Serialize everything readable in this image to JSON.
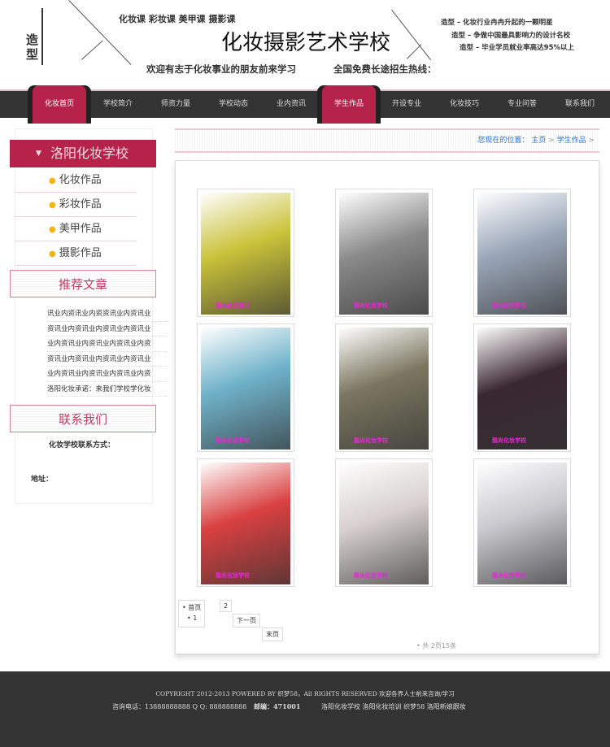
{
  "header": {
    "vertical_text": "造型",
    "courses": "化妆课 彩妆课 美甲课 摄影课",
    "title": "化妆摄影艺术学校",
    "welcome": "欢迎有志于化妆事业的朋友前来学习",
    "hotline": "全国免费长途招生热线：",
    "slogans": [
      "造型 – 化妆行业冉冉升起的一颗明星",
      "造型 – 争做中国最具影响力的设计名校",
      "造型 – 毕业学员就业率高达95%以上"
    ]
  },
  "nav": [
    {
      "label": "化妆首页",
      "active": true
    },
    {
      "label": "学校简介"
    },
    {
      "label": "师资力量"
    },
    {
      "label": "学校动态"
    },
    {
      "label": "业内资讯"
    },
    {
      "label": "学生作品",
      "active": true
    },
    {
      "label": "开设专业"
    },
    {
      "label": "化妆技巧"
    },
    {
      "label": "专业问答"
    },
    {
      "label": "联系我们"
    }
  ],
  "sidebar": {
    "title": "洛阳化妆学校",
    "items": [
      "化妆作品",
      "彩妆作品",
      "美甲作品",
      "摄影作品"
    ],
    "articles_title": "推荐文章",
    "articles": [
      "讯业内资讯业内资资讯业内资讯业",
      "资讯业内资讯业内资讯业内资讯业",
      "业内资讯业内资讯业内资讯业内资",
      "资讯业内资讯业内资讯业内资讯业",
      "业内资讯业内资讯业内资讯业内资",
      "洛阳化妆承诺：来我们学校学化妆"
    ],
    "contact_title": "联系我们",
    "contact_label": "化妆学校联系方式：",
    "address_label": "地址："
  },
  "breadcrumb": {
    "prefix": "您现在的位置：",
    "home": "主页",
    "current": "学生作品",
    "sep": ">"
  },
  "gallery": {
    "watermark": "靓尚化妆学校",
    "colors": [
      "#c9c23a",
      "#8a8a8a",
      "#9aa6b8",
      "#6fb2c9",
      "#7b7660",
      "#3a2730",
      "#d94040",
      "#d8d0d0",
      "#c9c9cf"
    ]
  },
  "pagination": {
    "first": "• 首页",
    "p1": "• 1",
    "p2": "2",
    "next": "下一页",
    "last": "末页",
    "total": "• 共 2页15条"
  },
  "footer": {
    "copyright": "COPYRIGHT 2012-2013 POWERED BY 织梦58，All RIGHTS RESERVED 欢迎各界人士前来咨询/学习",
    "phone": "咨询电话：13888888888 Q Q: 888888888",
    "postcode": "邮编：471001",
    "links": "洛阳化妆学校 洛阳化妆培训 织梦58 洛阳新娘跟妆"
  }
}
